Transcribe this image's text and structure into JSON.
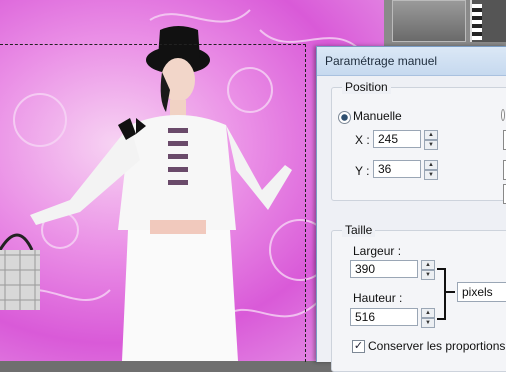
{
  "dialog": {
    "title": "Paramétrage manuel",
    "position": {
      "legend": "Position",
      "radio_label": "Manuelle",
      "x_label": "X :",
      "x_value": "245",
      "y_label": "Y :",
      "y_value": "36"
    },
    "size": {
      "legend": "Taille",
      "width_label": "Largeur :",
      "width_value": "390",
      "height_label": "Hauteur :",
      "height_value": "516",
      "unit_selected": "pixels",
      "keep_ratio_label": "Conserver les proportions",
      "keep_ratio_checked": true
    }
  },
  "colors": {
    "canvas_bg": "#d95ad8",
    "dialog_title_bg": "#c6d9ef"
  }
}
